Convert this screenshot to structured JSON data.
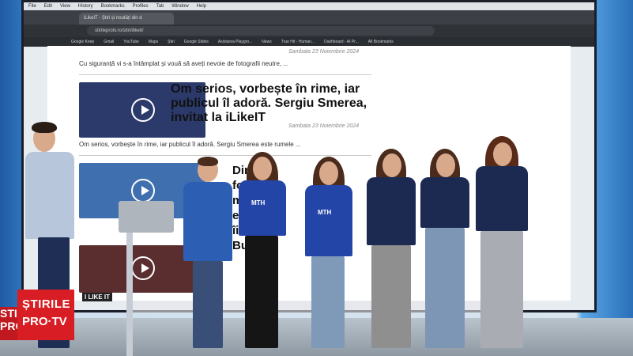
{
  "screen": {
    "menubar": [
      "File",
      "Edit",
      "View",
      "History",
      "Bookmarks",
      "Profiles",
      "Tab",
      "Window",
      "Help"
    ],
    "tab_title": "iLikeIT - Știri și noutăți din d",
    "url": "stirileprotv.ro/stiri/ilikeit/",
    "bookmarks": [
      "Google Keep",
      "Gmail",
      "YouTube",
      "Maps",
      "Știri",
      "Google Slides",
      "Asistarea Playgro...",
      "News",
      "True Hit - Human...",
      "Dashboard - AI Pr...",
      "All Bookmarks"
    ],
    "top_lead": "Cu siguranță vi s-a întâmplat și vouă să aveți nevoie de fotografii neutre, ...",
    "date1": "Sambata 23 Noiembrie 2024",
    "headline": "Om serios, vorbește în rime, iar publicul îl adoră. Sergiu Smerea, invitat la iLikeIT",
    "date2": "Sambata 23 Noiembrie 2024",
    "lead2": "Om serios, vorbește în rime, iar publicul îl adoră. Sergiu Smerea este rumele ...",
    "partial_headline_lines": [
      "Dirija",
      "folos",
      "ment",
      "emb",
      "îi",
      "Bucur"
    ],
    "thumb_badge": "I LIKE IT"
  },
  "shirts": [
    "MTH",
    "MTH"
  ],
  "logo": {
    "line1": "ȘTIRILE",
    "line2": "PRO·TV",
    "edge": "STIF PRO"
  },
  "colors": {
    "brand_red": "#d81e24",
    "navy": "#1c2a52",
    "shirt_blue": "#2445a8"
  }
}
